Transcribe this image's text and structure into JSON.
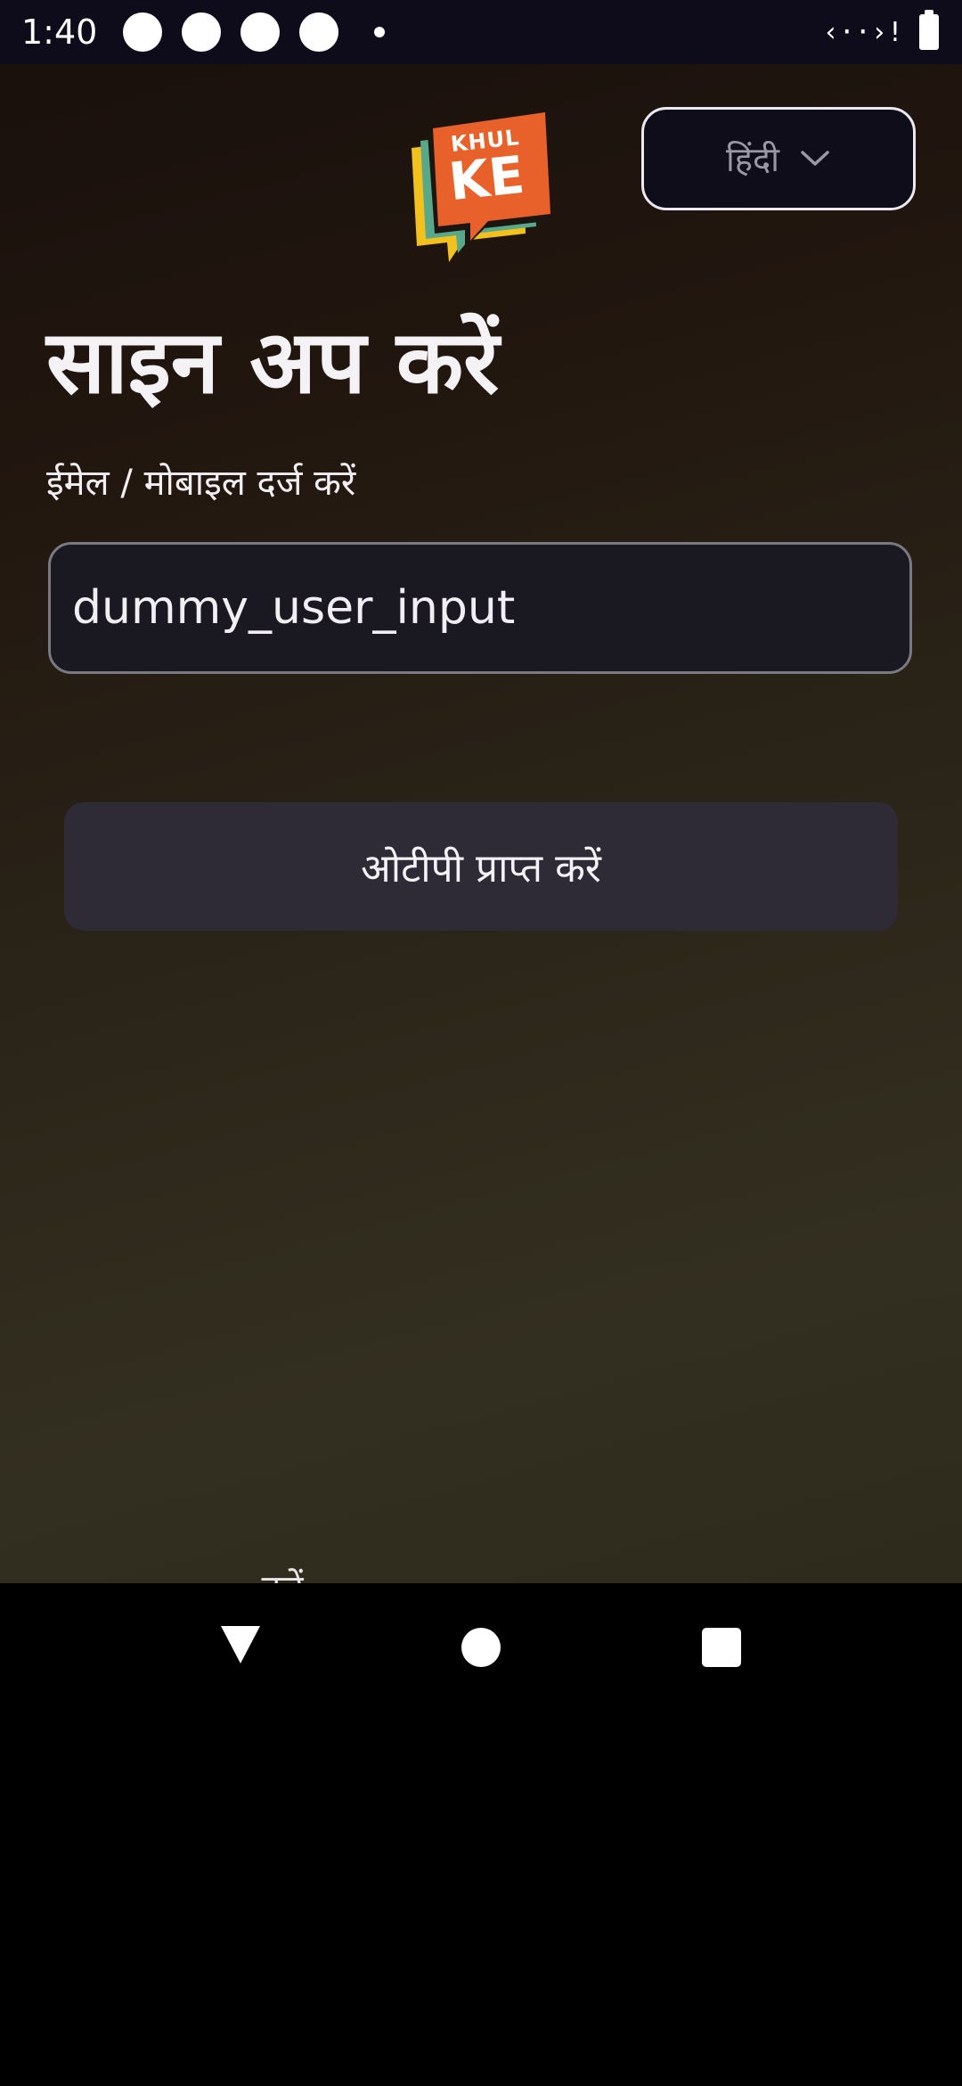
{
  "status_bar": {
    "time": "1:40",
    "data_indicator": "‹··›!"
  },
  "header": {
    "logo_text": [
      "KHUL",
      "KE"
    ],
    "language_selector": {
      "value": "हिंदी",
      "icon": "chevron-down-icon"
    }
  },
  "main": {
    "title": "साइन अप करें",
    "field_label": "ईमेल / मोबाइल दर्ज करें",
    "input_value": "dummy_user_input",
    "otp_button_label": "ओटीपी प्राप्त करें",
    "partial_bottom_text": "...  ... ... ... करें"
  },
  "colors": {
    "accent_logo": "#e8612a",
    "logo_teal": "#5aa88a",
    "logo_yellow": "#f2c11e",
    "button_bg": "#2e2a36",
    "input_border": "#7a7880"
  },
  "nav_bar": {
    "back_icon": "back-triangle-icon",
    "home_icon": "home-circle-icon",
    "recents_icon": "recents-square-icon"
  }
}
